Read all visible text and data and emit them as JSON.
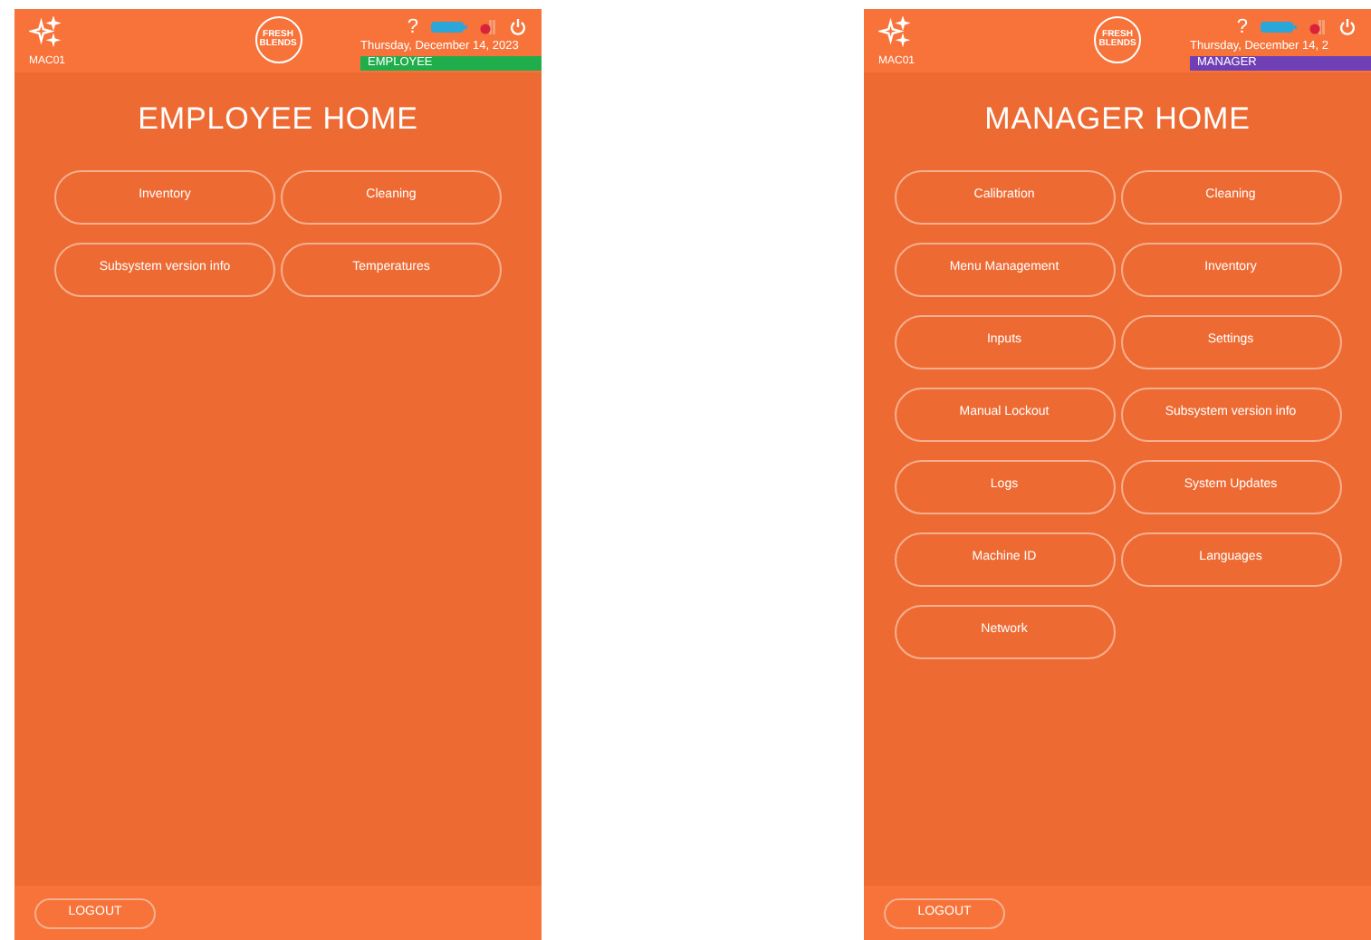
{
  "screens": [
    {
      "machine": "MAC01",
      "logo": [
        "FRESH",
        "BLENDS"
      ],
      "help": "?",
      "date": "Thursday, December 14, 2023",
      "role": {
        "label": "EMPLOYEE",
        "color": "#1fae4b"
      },
      "title": "EMPLOYEE HOME",
      "buttons": [
        "Inventory",
        "Cleaning",
        "Subsystem version info",
        "Temperatures"
      ],
      "logout": "LOGOUT"
    },
    {
      "machine": "MAC01",
      "logo": [
        "FRESH",
        "BLENDS"
      ],
      "help": "?",
      "date": "Thursday, December 14, 2",
      "role": {
        "label": "MANAGER",
        "color": "#6f3fb5"
      },
      "title": "MANAGER HOME",
      "buttons": [
        "Calibration",
        "Cleaning",
        "Menu Management",
        "Inventory",
        "Inputs",
        "Settings",
        "Manual Lockout",
        "Subsystem version info",
        "Logs",
        "System Updates",
        "Machine ID",
        "Languages",
        "Network"
      ],
      "logout": "LOGOUT"
    }
  ]
}
